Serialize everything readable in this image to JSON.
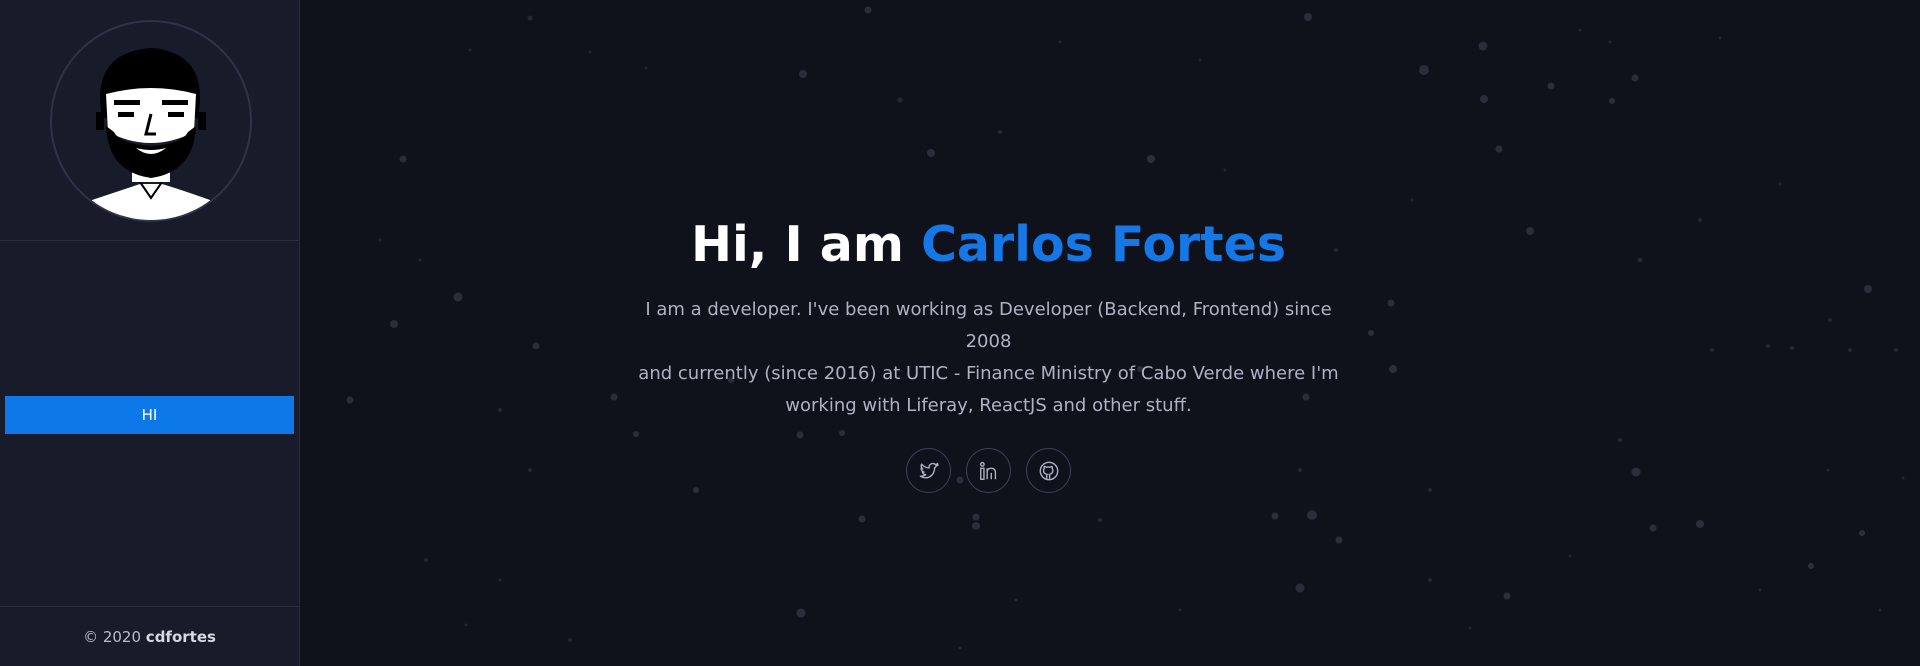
{
  "sidebar": {
    "avatar_icon": "portrait-avatar",
    "nav": [
      {
        "label": "HI",
        "active": true
      }
    ],
    "footer": {
      "prefix": "© 2020",
      "brand": "cdfortes"
    }
  },
  "hero": {
    "greeting": "Hi, I am",
    "name": "Carlos Fortes",
    "bio_lines": [
      "I am a developer. I've been working as Developer (Backend, Frontend) since 2008",
      "and currently (since 2016) at UTIC - Finance Ministry of Cabo Verde where I'm",
      "working with Liferay, ReactJS and other stuff."
    ],
    "socials": [
      {
        "icon": "twitter-icon"
      },
      {
        "icon": "linkedin-icon"
      },
      {
        "icon": "github-icon"
      }
    ]
  },
  "colors": {
    "accent": "#0d78e8",
    "name_highlight": "#1678e6",
    "main_bg": "#0f121b",
    "sidebar_bg": "#181b29"
  }
}
